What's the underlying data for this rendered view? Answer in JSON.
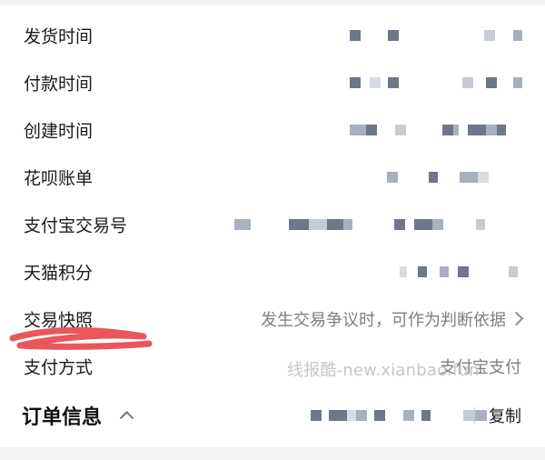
{
  "rows": [
    {
      "label": "发货时间"
    },
    {
      "label": "付款时间"
    },
    {
      "label": "创建时间"
    },
    {
      "label": "花呗账单"
    },
    {
      "label": "支付宝交易号"
    },
    {
      "label": "天猫积分"
    },
    {
      "label": "交易快照",
      "value": "发生交易争议时，可作为判断依据"
    },
    {
      "label": "支付方式",
      "value": "支付宝支付"
    }
  ],
  "order_info": {
    "title": "订单信息",
    "copy_label": "复制"
  },
  "watermark": "线报酷-new.xianbao.fun",
  "colors": {
    "pixel_dark": "#6e7788",
    "pixel_mid": "#a9b0bd",
    "pixel_light": "#d8dce3",
    "scribble": "#e8383d",
    "muted_text": "#7a7f87"
  }
}
